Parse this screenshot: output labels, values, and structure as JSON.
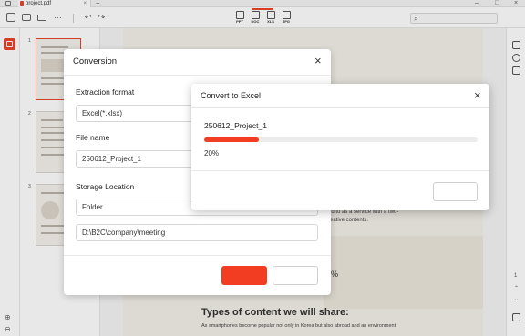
{
  "titlebar": {
    "tab_title": "project.pdf",
    "tab_close": "×",
    "new_tab": "+",
    "minimize": "–",
    "maximize": "□",
    "close": "×"
  },
  "toolbar": {
    "icons": [
      "sidebar-toggle-icon",
      "print-icon",
      "mail-icon",
      "more-icon",
      "undo-icon",
      "redo-icon"
    ],
    "more_label": "···",
    "undo_label": "↶",
    "redo_label": "↷",
    "formats": [
      "PPT",
      "DOC",
      "XLS",
      "JPG"
    ],
    "search": {
      "icon": "search-icon",
      "glyph": "⌕",
      "value": ""
    }
  },
  "thumbnails": {
    "pages": [
      "1",
      "2",
      "3"
    ],
    "selected": "1"
  },
  "sidebar": {
    "zoom_in": "⊕",
    "zoom_out": "⊖"
  },
  "document": {
    "fragment_1": "ed to as a service with a two-",
    "fragment_2": "reative contents.",
    "percent": "%",
    "heading": "Types of content we will share:",
    "paragraph": "As smartphones become popular not only in Korea but also abroad and an environment"
  },
  "rightbar": {
    "page_indicator": "1",
    "page_up": "⌃",
    "page_down": "⌄"
  },
  "conversion_dialog": {
    "title": "Conversion",
    "close": "×",
    "extraction_format_label": "Extraction format",
    "extraction_format_value": "Excel(*.xlsx)",
    "file_name_label": "File name",
    "file_name_value": "250612_Project_1",
    "storage_location_label": "Storage Location",
    "storage_type_value": "Folder",
    "storage_path_value": "D:\\B2C\\company\\meeting"
  },
  "progress_dialog": {
    "title": "Convert to Excel",
    "close": "×",
    "file_name": "250612_Project_1",
    "progress_text": "20%",
    "progress_fraction": 0.2
  },
  "colors": {
    "accent": "#f23d22",
    "page_bg": "#f3efe8"
  }
}
